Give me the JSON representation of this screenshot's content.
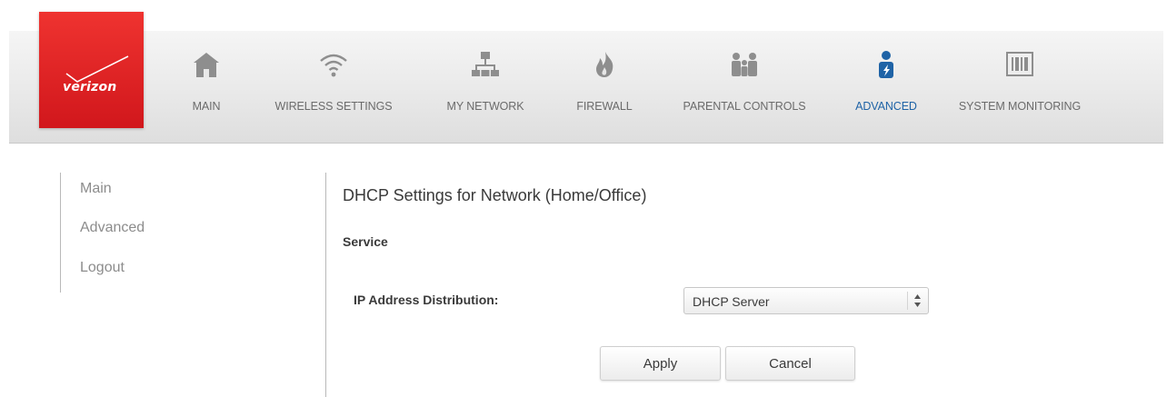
{
  "brand": {
    "logo_text": "verizon",
    "accent": "#e3231f"
  },
  "nav": {
    "items": [
      {
        "label": "MAIN",
        "icon": "home-icon",
        "active": false
      },
      {
        "label": "WIRELESS SETTINGS",
        "icon": "wifi-icon",
        "active": false
      },
      {
        "label": "MY NETWORK",
        "icon": "network-icon",
        "active": false
      },
      {
        "label": "FIREWALL",
        "icon": "flame-icon",
        "active": false
      },
      {
        "label": "PARENTAL CONTROLS",
        "icon": "family-icon",
        "active": false
      },
      {
        "label": "ADVANCED",
        "icon": "advanced-user-icon",
        "active": true
      },
      {
        "label": "SYSTEM MONITORING",
        "icon": "monitor-icon",
        "active": false
      }
    ],
    "active_color": "#1f63a6"
  },
  "sidebar": {
    "items": [
      {
        "label": "Main"
      },
      {
        "label": "Advanced"
      },
      {
        "label": "Logout"
      }
    ]
  },
  "main": {
    "title": "DHCP Settings for Network (Home/Office)",
    "section_title": "Service",
    "ip_distribution": {
      "label": "IP Address Distribution:",
      "value": "DHCP Server"
    },
    "buttons": {
      "apply": "Apply",
      "cancel": "Cancel"
    }
  }
}
